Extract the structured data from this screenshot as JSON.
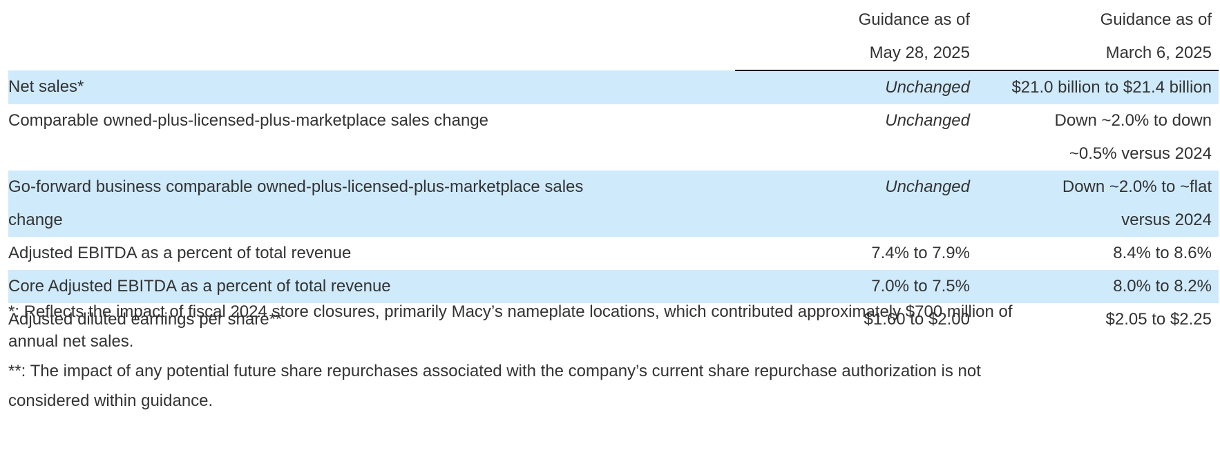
{
  "header": {
    "col_may_line1": "Guidance as of",
    "col_may_line2": "May 28, 2025",
    "col_mar_line1": "Guidance as of",
    "col_mar_line2": "March 6, 2025"
  },
  "rows": [
    {
      "label": "Net sales*",
      "may": "Unchanged",
      "mar_lines": [
        "$21.0 billion to $21.4 billion"
      ]
    },
    {
      "label": "Comparable owned-plus-licensed-plus-marketplace sales change",
      "may": "Unchanged",
      "mar_lines": [
        "Down ~2.0% to down",
        "~0.5% versus 2024"
      ]
    },
    {
      "label_lines": [
        "Go-forward business comparable owned-plus-licensed-plus-marketplace sales",
        "change"
      ],
      "may": "Unchanged",
      "mar_lines": [
        "Down ~2.0% to ~flat",
        "versus 2024"
      ]
    },
    {
      "label": "Adjusted EBITDA as a percent of total revenue",
      "may": "7.4% to 7.9%",
      "mar_lines": [
        "8.4% to 8.6%"
      ]
    },
    {
      "label": "Core Adjusted EBITDA as a percent of total revenue",
      "may": "7.0% to 7.5%",
      "mar_lines": [
        "8.0% to 8.2%"
      ]
    },
    {
      "label": "Adjusted diluted earnings per share**",
      "may": "$1.60 to $2.00",
      "mar_lines": [
        "$2.05 to $2.25"
      ]
    }
  ],
  "footnotes": {
    "note1_line1": "*: Reflects the impact of fiscal 2024 store closures, primarily Macy’s nameplate locations, which contributed approximately $700 million of",
    "note1_line2": "annual net sales.",
    "note2_line1": "**: The impact of any potential future share repurchases associated with the company’s current share repurchase authorization is not",
    "note2_line2": "considered within guidance."
  },
  "colors": {
    "row_shade": "#cfeafb",
    "text": "#333333",
    "rule": "#111111"
  }
}
